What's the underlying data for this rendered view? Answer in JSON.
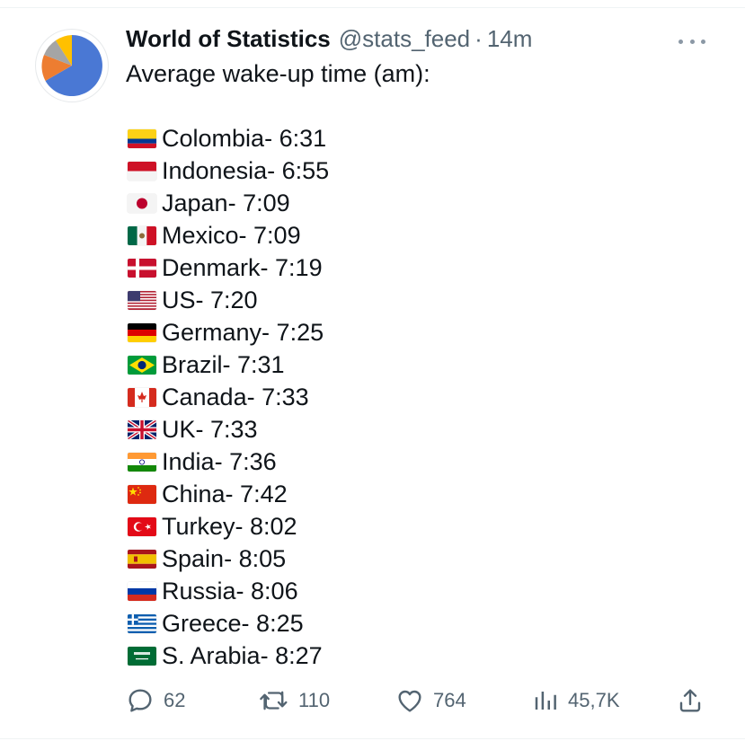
{
  "tweet": {
    "author_name": "World of Statistics",
    "handle": "@stats_feed",
    "separator": "·",
    "time": "14m",
    "intro": "Average wake-up time (am):",
    "items": [
      {
        "country": "Colombia",
        "time": "6:31",
        "flag": "colombia-flag-icon"
      },
      {
        "country": "Indonesia",
        "time": "6:55",
        "flag": "indonesia-flag-icon"
      },
      {
        "country": "Japan",
        "time": "7:09",
        "flag": "japan-flag-icon"
      },
      {
        "country": "Mexico",
        "time": "7:09",
        "flag": "mexico-flag-icon"
      },
      {
        "country": "Denmark",
        "time": "7:19",
        "flag": "denmark-flag-icon"
      },
      {
        "country": "US",
        "time": "7:20",
        "flag": "us-flag-icon"
      },
      {
        "country": "Germany",
        "time": "7:25",
        "flag": "germany-flag-icon"
      },
      {
        "country": "Brazil",
        "time": "7:31",
        "flag": "brazil-flag-icon"
      },
      {
        "country": "Canada",
        "time": "7:33",
        "flag": "canada-flag-icon"
      },
      {
        "country": "UK",
        "time": "7:33",
        "flag": "uk-flag-icon"
      },
      {
        "country": "India",
        "time": "7:36",
        "flag": "india-flag-icon"
      },
      {
        "country": "China",
        "time": "7:42",
        "flag": "china-flag-icon"
      },
      {
        "country": "Turkey",
        "time": "8:02",
        "flag": "turkey-flag-icon"
      },
      {
        "country": "Spain",
        "time": "8:05",
        "flag": "spain-flag-icon"
      },
      {
        "country": "Russia",
        "time": "8:06",
        "flag": "russia-flag-icon"
      },
      {
        "country": "Greece",
        "time": "8:25",
        "flag": "greece-flag-icon"
      },
      {
        "country": "S. Arabia",
        "time": "8:27",
        "flag": "saudi-arabia-flag-icon"
      }
    ],
    "actions": {
      "replies": "62",
      "retweets": "110",
      "likes": "764",
      "views": "45,7K"
    }
  },
  "colors": {
    "text_primary": "#0f1419",
    "text_secondary": "#536471",
    "divider": "#eff3f4",
    "avatar_blue": "#4a78d4",
    "avatar_orange": "#ed7d31",
    "avatar_gray": "#a5a5a5",
    "avatar_yellow": "#ffc000"
  },
  "icons": {
    "avatar": "pie-chart-avatar",
    "more": "more-dots-icon",
    "reply": "reply-icon",
    "retweet": "retweet-icon",
    "like": "heart-icon",
    "views": "views-bar-icon",
    "share": "share-icon"
  }
}
